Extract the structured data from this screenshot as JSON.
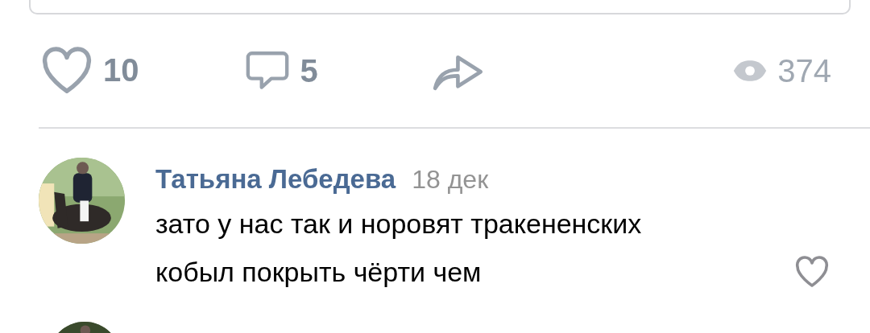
{
  "post_actions": {
    "likes": {
      "count": "10",
      "liked": false
    },
    "comments": {
      "count": "5"
    },
    "views": {
      "count": "374"
    }
  },
  "comments": [
    {
      "author": "Татьяна Лебедева",
      "date": "18 дек",
      "lines": [
        "зато у нас так и норовят тракененских",
        "кобыл покрыть чёрти чем"
      ],
      "liked": false
    }
  ]
}
